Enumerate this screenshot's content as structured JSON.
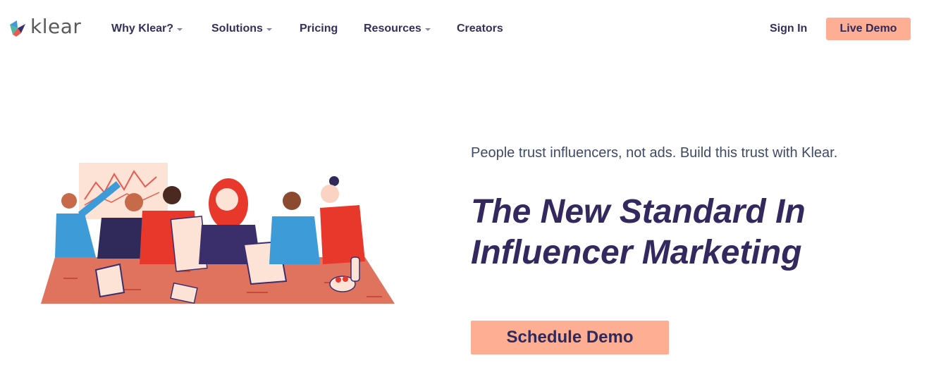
{
  "brand": {
    "name": "klear",
    "colors": {
      "accent": "#fdae93",
      "navy": "#33295f",
      "logo_blue": "#3d9bd7",
      "logo_red": "#e85a4f",
      "logo_purple": "#3b2f6b",
      "logo_green": "#4fb8a0"
    }
  },
  "nav": {
    "items": [
      {
        "label": "Why Klear?",
        "dropdown": true
      },
      {
        "label": "Solutions",
        "dropdown": true
      },
      {
        "label": "Pricing",
        "dropdown": false
      },
      {
        "label": "Resources",
        "dropdown": true
      },
      {
        "label": "Creators",
        "dropdown": false
      }
    ],
    "sign_in": "Sign In",
    "live_demo": "Live Demo"
  },
  "hero": {
    "tagline": "People trust influencers, not ads. Build this trust with Klear.",
    "headline_line1": "The New Standard In",
    "headline_line2": "Influencer Marketing",
    "cta": "Schedule Demo",
    "illustration": "team-meeting-illustration"
  }
}
